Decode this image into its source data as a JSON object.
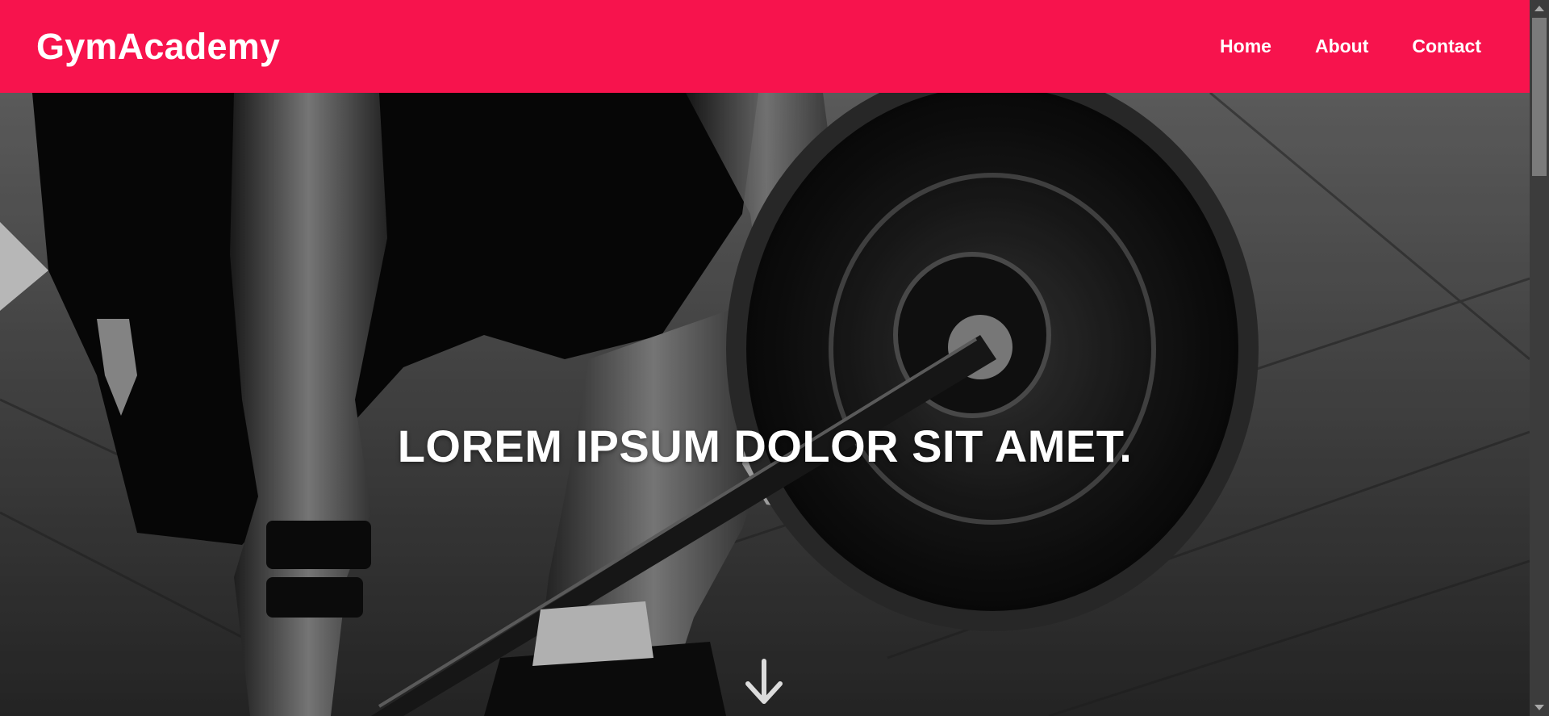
{
  "header": {
    "brand": "GymAcademy",
    "nav": [
      {
        "label": "Home"
      },
      {
        "label": "About"
      },
      {
        "label": "Contact"
      }
    ],
    "background_color": "#f7134d"
  },
  "hero": {
    "headline": "LOREM IPSUM DOLOR SIT AMET.",
    "scroll_icon": "arrow-down-icon"
  },
  "scrollbar": {
    "up_icon": "triangle-up-icon",
    "down_icon": "triangle-down-icon"
  }
}
